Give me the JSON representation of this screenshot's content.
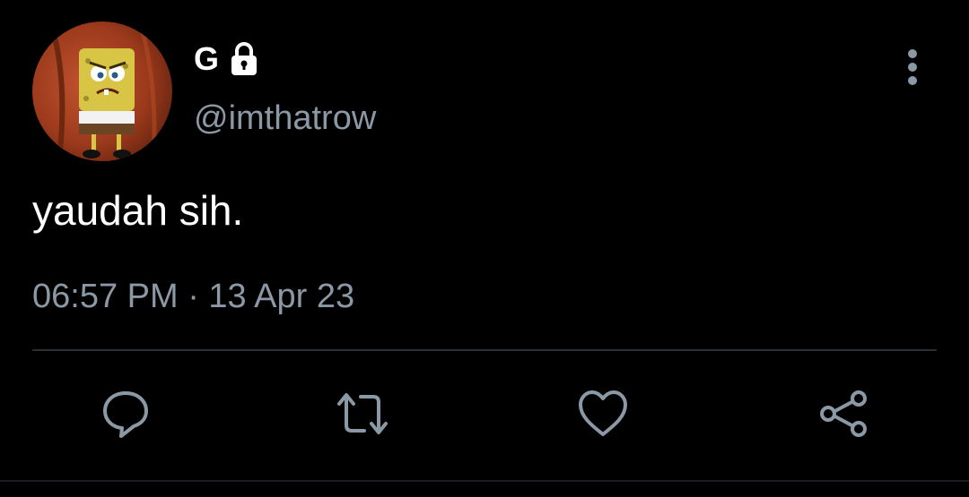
{
  "tweet": {
    "display_name": "G",
    "handle": "@imthatrow",
    "text": "yaudah sih.",
    "timestamp": "06:57 PM · 13 Apr 23",
    "protected_icon": "lock-icon",
    "avatar": "spongebob-angry-avatar"
  },
  "actions": [
    {
      "name": "reply",
      "icon": "reply-bubble-icon"
    },
    {
      "name": "retweet",
      "icon": "retweet-icon"
    },
    {
      "name": "like",
      "icon": "heart-icon"
    },
    {
      "name": "share",
      "icon": "share-icon"
    }
  ],
  "menu": {
    "icon": "more-vertical-icon"
  },
  "colors": {
    "background": "#000000",
    "primary_text": "#ffffff",
    "secondary_text": "#8b98a5",
    "icon": "#8b98a5",
    "divider": "#2a2f33"
  }
}
